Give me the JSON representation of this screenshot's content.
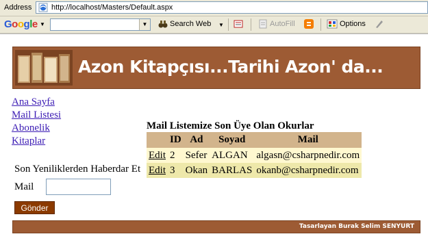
{
  "browser": {
    "address_label": "Address",
    "url": "http://localhost/Masters/Default.aspx"
  },
  "toolbar": {
    "google_letters": [
      "G",
      "o",
      "o",
      "g",
      "l",
      "e"
    ],
    "search_web": "Search Web",
    "autofill": "AutoFill",
    "options": "Options"
  },
  "banner": {
    "title": "Azon Kitapçısı...Tarihi Azon' da..."
  },
  "menu": {
    "items": [
      {
        "label": "Ana Sayfa"
      },
      {
        "label": "Mail Listesi"
      },
      {
        "label": "Abonelik"
      },
      {
        "label": "Kitaplar"
      }
    ]
  },
  "members": {
    "caption": "Mail Listemize Son Üye Olan Okurlar",
    "headers": {
      "id": "ID",
      "ad": "Ad",
      "soyad": "Soyad",
      "mail": "Mail"
    },
    "rows": [
      {
        "edit": "Edit",
        "id": "2",
        "ad": "Sefer",
        "soyad": "ALGAN",
        "mail": "algasn@csharpnedir.com"
      },
      {
        "edit": "Edit",
        "id": "3",
        "ad": "Okan",
        "soyad": "BARLAS",
        "mail": "okanb@csharpnedir.com"
      }
    ]
  },
  "newsletter": {
    "label": "Son Yeniliklerden Haberdar Et",
    "mail_label": "Mail",
    "mail_value": "",
    "send_button": "Gönder"
  },
  "footer": {
    "text": "Tasarlayan Burak Selim SENYURT"
  },
  "colors": {
    "banner_bg": "#9d5b34",
    "header_bg": "#d2b48c",
    "row_light": "#fff8d0",
    "row_dark": "#eee8aa",
    "button_bg": "#8b3a00",
    "link": "#3b1bb4"
  }
}
